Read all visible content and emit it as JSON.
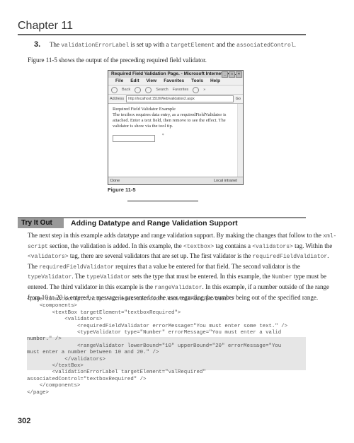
{
  "header": {
    "chapter": "Chapter 11"
  },
  "step": {
    "number": "3.",
    "text_1": "The ",
    "code_1": "validationErrorLabel",
    "text_2": " is set up with a ",
    "code_2": "targetElement",
    "text_3": " and the ",
    "code_3": "associatedControl",
    "text_4": "."
  },
  "intro_paragraph": "Figure 11-5 shows the output of the preceding required field validator.",
  "figure": {
    "browser": {
      "title": "Required Field Validation Page. - Microsoft Internet Exp...",
      "window_buttons": [
        "_",
        "□",
        "×"
      ],
      "menu": [
        "File",
        "Edit",
        "View",
        "Favorites",
        "Tools",
        "Help"
      ],
      "toolbar": {
        "back": "Back",
        "search": "Search",
        "favorites": "Favorites",
        "more": "»"
      },
      "address_label": "Address",
      "address_value": "http://localhost:1518/Web/validation2.aspx",
      "go_label": "Go",
      "content": {
        "heading": "Required Field Validator Example",
        "text": "The textbox requires data entry, as a requiredFieldValidator is attached. Enter a text field, then remove to see the effect. The validator is show via the tool tip.",
        "input_value": "",
        "required_marker": "*"
      },
      "status": {
        "left": "Done",
        "right": "Local intranet"
      }
    },
    "caption": "Figure 11-5"
  },
  "try_it_out": {
    "label": "Try It Out",
    "title": "Adding Datatype and Range Validation Support"
  },
  "body_paragraph": [
    {
      "t": "The next step in this example adds datatype and range validation support. By making the changes that follow to the "
    },
    {
      "c": "xml-script"
    },
    {
      "t": " section, the validation is added. In this example, the "
    },
    {
      "c": "<textbox>"
    },
    {
      "t": " tag contains a "
    },
    {
      "c": "<validators>"
    },
    {
      "t": " tag. Within the "
    },
    {
      "c": "<validators>"
    },
    {
      "t": " tag, there are several validators that are set up. The first validator is the "
    },
    {
      "c": "requiredFieldValdiator"
    },
    {
      "t": ". The "
    },
    {
      "c": "requiredFieldValidator"
    },
    {
      "t": " requires that a value be entered for that field. The second validator is the "
    },
    {
      "c": "typeValidator"
    },
    {
      "t": ". The "
    },
    {
      "c": "typeValidator"
    },
    {
      "t": " sets the type that must be entered. In this example, the "
    },
    {
      "c": "Number"
    },
    {
      "t": " type must be entered. The third validator in this example is the "
    },
    {
      "c": "rangeValidator"
    },
    {
      "t": ". In this example, if a number outside of the range from 10 to 20 is entered, a message is presented to the user regarding the number being out of the specified range."
    }
  ],
  "code_lines": [
    "<page xmlns:script=\"http://schemas.microsoft.com/xml-script/2005\">",
    "    <components>",
    "        <textBox targetElement=\"textboxRequired\">",
    "            <validators>",
    "                <requiredFieldValidator errorMessage=\"You must enter some text.\" />",
    "                <typeValidator type=\"Number\" errorMessage=\"You must enter a valid",
    "number.\" />",
    "                <rangeValidator lowerBound=\"10\" upperBound=\"20\" errorMessage=\"You",
    "must enter a number between 10 and 20.\" />",
    "            </validators>",
    "        </textBox>",
    "        <validationErrorLabel targetElement=\"valRequired\"",
    "associatedControl=\"textboxRequired\" />",
    "    </components>",
    "</page>"
  ],
  "highlight": {
    "color": "#e6e6e6"
  },
  "page_number": "302"
}
